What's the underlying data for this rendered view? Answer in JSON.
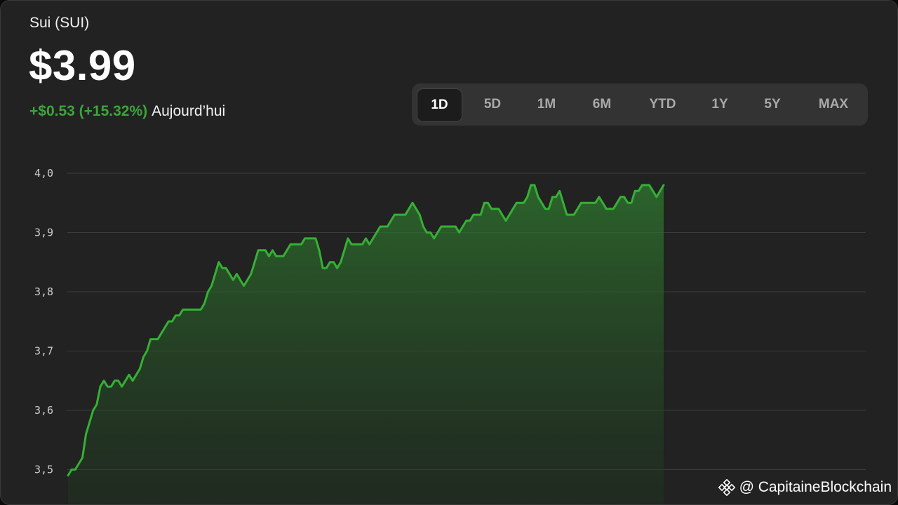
{
  "header": {
    "asset_name": "Sui (SUI)",
    "price": "$3.99",
    "change": "+$0.53 (+15.32%)",
    "period": "Aujourd’hui"
  },
  "ranges": [
    {
      "label": "1D",
      "active": true
    },
    {
      "label": "5D",
      "active": false
    },
    {
      "label": "1M",
      "active": false
    },
    {
      "label": "6M",
      "active": false
    },
    {
      "label": "YTD",
      "active": false
    },
    {
      "label": "1Y",
      "active": false
    },
    {
      "label": "5Y",
      "active": false
    },
    {
      "label": "MAX",
      "active": false
    }
  ],
  "watermark": {
    "handle": "@ CapitaineBlockchain"
  },
  "colors": {
    "accent": "#3aa63a",
    "line": "#35b035",
    "background": "#222222",
    "grid": "#3c3c3c"
  },
  "chart_data": {
    "type": "area",
    "title": "",
    "xlabel": "",
    "ylabel": "",
    "ylim": [
      3.48,
      4.0
    ],
    "xlim": [
      0,
      270
    ],
    "yticks": [
      4.0,
      3.9,
      3.8,
      3.7,
      3.6,
      3.5
    ],
    "ytick_labels": [
      "4,0",
      "3,9",
      "3,8",
      "3,7",
      "3,6",
      "3,5"
    ],
    "grid": true,
    "legend": "none",
    "series": [
      {
        "values": [
          3.49,
          3.5,
          3.5,
          3.51,
          3.52,
          3.56,
          3.58,
          3.6,
          3.61,
          3.64,
          3.65,
          3.64,
          3.64,
          3.65,
          3.65,
          3.64,
          3.65,
          3.66,
          3.65,
          3.66,
          3.67,
          3.69,
          3.7,
          3.72,
          3.72,
          3.72,
          3.73,
          3.74,
          3.75,
          3.75,
          3.76,
          3.76,
          3.77,
          3.77,
          3.77,
          3.77,
          3.77,
          3.77,
          3.78,
          3.8,
          3.81,
          3.83,
          3.85,
          3.84,
          3.84,
          3.83,
          3.82,
          3.83,
          3.82,
          3.81,
          3.82,
          3.83,
          3.85,
          3.87,
          3.87,
          3.87,
          3.86,
          3.87,
          3.86,
          3.86,
          3.86,
          3.87,
          3.88,
          3.88,
          3.88,
          3.88,
          3.89,
          3.89,
          3.89,
          3.89,
          3.87,
          3.84,
          3.84,
          3.85,
          3.85,
          3.84,
          3.85,
          3.87,
          3.89,
          3.88,
          3.88,
          3.88,
          3.88,
          3.89,
          3.88,
          3.89,
          3.9,
          3.91,
          3.91,
          3.91,
          3.92,
          3.93,
          3.93,
          3.93,
          3.93,
          3.94,
          3.95,
          3.94,
          3.93,
          3.91,
          3.9,
          3.9,
          3.89,
          3.9,
          3.91,
          3.91,
          3.91,
          3.91,
          3.91,
          3.9,
          3.91,
          3.92,
          3.92,
          3.93,
          3.93,
          3.93,
          3.95,
          3.95,
          3.94,
          3.94,
          3.94,
          3.93,
          3.92,
          3.93,
          3.94,
          3.95,
          3.95,
          3.95,
          3.96,
          3.98,
          3.98,
          3.96,
          3.95,
          3.94,
          3.94,
          3.96,
          3.96,
          3.97,
          3.95,
          3.93,
          3.93,
          3.93,
          3.94,
          3.95,
          3.95,
          3.95,
          3.95,
          3.95,
          3.96,
          3.95,
          3.94,
          3.94,
          3.94,
          3.95,
          3.96,
          3.96,
          3.95,
          3.95,
          3.97,
          3.97,
          3.98,
          3.98,
          3.98,
          3.97,
          3.96,
          3.97,
          3.98
        ]
      }
    ]
  }
}
